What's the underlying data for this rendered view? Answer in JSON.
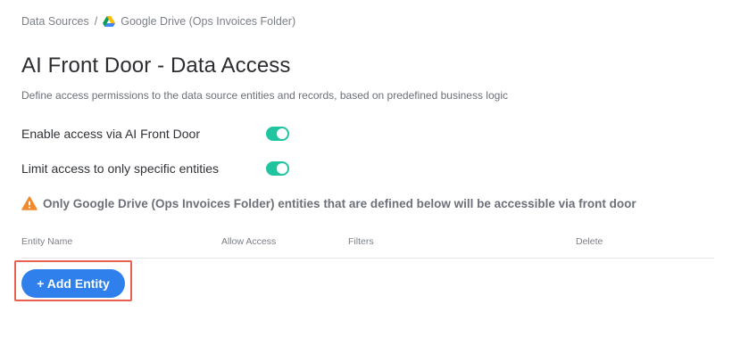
{
  "breadcrumb": {
    "root": "Data Sources",
    "separator": "/",
    "current": "Google Drive (Ops Invoices Folder)",
    "current_icon": "google-drive-icon"
  },
  "header": {
    "title": "AI Front Door - Data Access",
    "subtitle": "Define access permissions to the data source entities and records, based on predefined business logic"
  },
  "settings": [
    {
      "label": "Enable access via AI Front Door",
      "enabled": true
    },
    {
      "label": "Limit access to only specific entities",
      "enabled": true
    }
  ],
  "warning": {
    "icon": "warning-triangle-icon",
    "text": "Only Google Drive (Ops Invoices Folder) entities that are defined below will be accessible via front door"
  },
  "table": {
    "columns": [
      "Entity Name",
      "Allow Access",
      "Filters",
      "Delete"
    ],
    "rows": []
  },
  "actions": {
    "add_entity_label": "+ Add Entity"
  },
  "colors": {
    "toggle_on": "#20c5a0",
    "primary_button": "#2f80ed",
    "highlight_outline": "#e8604f",
    "warning": "#f08a2c"
  }
}
